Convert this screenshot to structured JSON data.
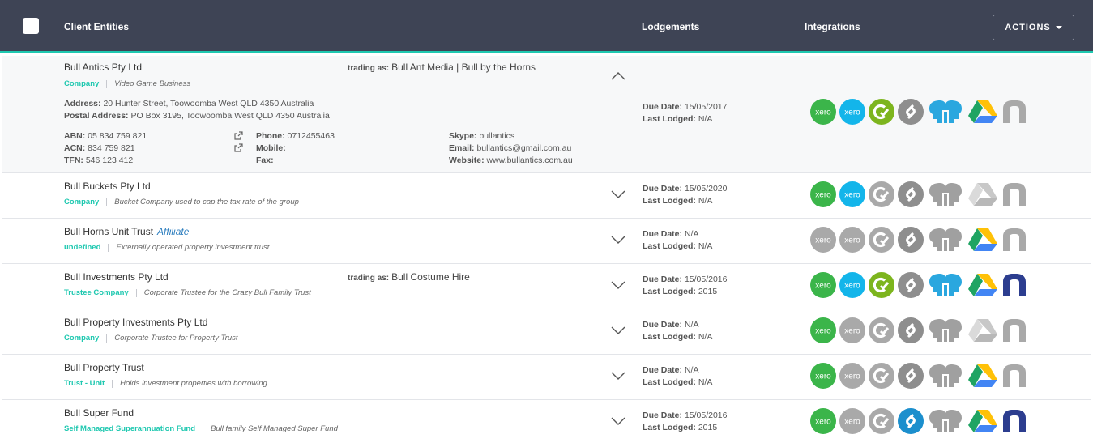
{
  "header": {
    "col_entities": "Client Entities",
    "col_lodgements": "Lodgements",
    "col_integrations": "Integrations",
    "actions_label": "ACTIONS"
  },
  "labels": {
    "trading_as": "trading as:",
    "due_date": "Due Date:",
    "last_lodged": "Last Lodged:",
    "address": "Address:",
    "postal_address": "Postal Address:",
    "abn": "ABN:",
    "acn": "ACN:",
    "tfn": "TFN:",
    "phone": "Phone:",
    "mobile": "Mobile:",
    "fax": "Fax:",
    "skype": "Skype:",
    "email": "Email:",
    "website": "Website:"
  },
  "rows": [
    {
      "name": "Bull Antics Pty Ltd",
      "type": "Company",
      "desc": "Video Game Business",
      "trading": "Bull Ant Media | Bull by the Horns",
      "due": "15/05/2017",
      "lodged": "N/A",
      "details": {
        "address": "20 Hunter Street, Toowoomba West QLD 4350 Australia",
        "postal": "PO Box 3195, Toowoomba West QLD 4350 Australia",
        "abn": "05 834 759 821",
        "acn": "834 759 821",
        "tfn": "546 123 412",
        "phone": "0712455463",
        "mobile": "",
        "fax": "",
        "skype": "bullantics",
        "email": "bullantics@gmail.com.au",
        "website": "www.bullantics.com.au"
      },
      "integrations": {
        "xero1": true,
        "xero2": true,
        "cyclic": true,
        "sync": false,
        "heads": true,
        "drive": true,
        "n": false
      }
    },
    {
      "name": "Bull Buckets Pty Ltd",
      "type": "Company",
      "desc": "Bucket Company used to cap the tax rate of the group",
      "due": "15/05/2020",
      "lodged": "N/A",
      "integrations": {
        "xero1": true,
        "xero2": true,
        "cyclic": false,
        "sync": false,
        "heads": false,
        "drive": false,
        "n": false
      }
    },
    {
      "name": "Bull Horns Unit Trust",
      "affiliate": "Affiliate",
      "type": "undefined",
      "desc": "Externally operated property investment trust.",
      "due": "N/A",
      "lodged": "N/A",
      "integrations": {
        "xero1": false,
        "xero2": false,
        "cyclic": false,
        "sync": false,
        "heads": false,
        "drive": true,
        "n": false
      }
    },
    {
      "name": "Bull Investments Pty Ltd",
      "type": "Trustee Company",
      "desc": "Corporate Trustee for the Crazy Bull Family Trust",
      "trading": "Bull Costume Hire",
      "due": "15/05/2016",
      "lodged": "2015",
      "integrations": {
        "xero1": true,
        "xero2": true,
        "cyclic": true,
        "sync": false,
        "heads": true,
        "drive": true,
        "n": true
      }
    },
    {
      "name": "Bull Property Investments Pty Ltd",
      "type": "Company",
      "desc": "Corporate Trustee for Property Trust",
      "due": "N/A",
      "lodged": "N/A",
      "integrations": {
        "xero1": true,
        "xero2": false,
        "cyclic": false,
        "sync": false,
        "heads": false,
        "drive": false,
        "n": false
      }
    },
    {
      "name": "Bull Property Trust",
      "type": "Trust - Unit",
      "desc": "Holds investment properties with borrowing",
      "due": "N/A",
      "lodged": "N/A",
      "integrations": {
        "xero1": true,
        "xero2": false,
        "cyclic": false,
        "sync": false,
        "heads": false,
        "drive": true,
        "n": false
      }
    },
    {
      "name": "Bull Super Fund",
      "type": "Self Managed Superannuation Fund",
      "desc": "Bull family Self Managed Super Fund",
      "due": "15/05/2016",
      "lodged": "2015",
      "integrations": {
        "xero1": true,
        "xero2": false,
        "cyclic": false,
        "sync": true,
        "heads": false,
        "drive": true,
        "n": true
      }
    }
  ],
  "colors": {
    "header_bg": "#3e4455",
    "accent": "#1fc8b0",
    "xero_green": "#3bb54a",
    "xero_blue": "#13b5ea",
    "cyclic_green": "#7db51e",
    "sync_active": "#1c8fcd",
    "heads_blue": "#2aa7df",
    "n_navy": "#2c3d8f",
    "inactive_gray": "#a9a9a9"
  },
  "icon_names": [
    "xero-icon",
    "xero-icon",
    "cyclic-icon",
    "sync-icon",
    "heads-icon",
    "google-drive-icon",
    "n-icon"
  ]
}
